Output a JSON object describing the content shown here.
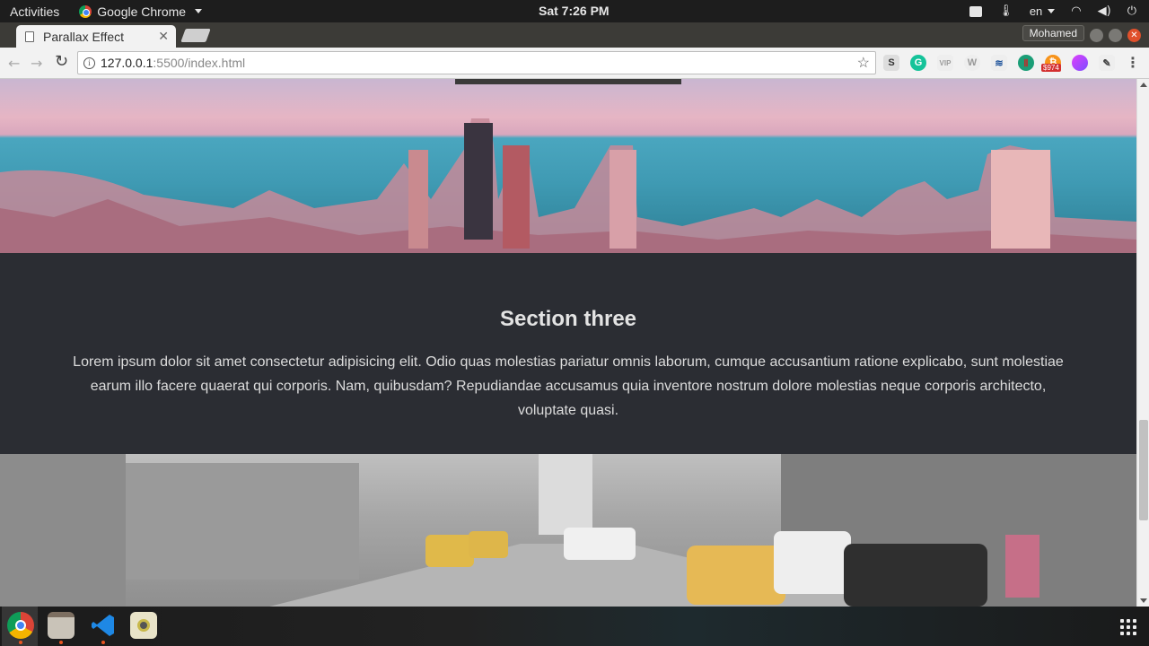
{
  "system_bar": {
    "activities": "Activities",
    "app_name": "Google Chrome",
    "clock": "Sat  7:26 PM",
    "language": "en"
  },
  "browser": {
    "tab_title": "Parallax Effect",
    "profile_name": "Mohamed",
    "url_host": "127.0.0.1",
    "url_rest": ":5500/index.html",
    "extension_badge": "$974"
  },
  "page": {
    "section_three": {
      "heading": "Section three",
      "body": "Lorem ipsum dolor sit amet consectetur adipisicing elit. Odio quas molestias pariatur omnis laborum, cumque accusantium ratione explicabo, sunt molestiae earum illo facere quaerat qui corporis. Nam, quibusdam? Repudiandae accusamus quia inventore nostrum dolore molestias neque corporis architecto, voluptate quasi."
    }
  },
  "dock": {
    "apps": [
      "chrome-icon",
      "files-icon",
      "vscode-icon",
      "rhythmbox-icon",
      "show-apps-icon"
    ]
  },
  "colors": {
    "section_bg": "#2b2d33",
    "ubuntu_orange": "#e95420",
    "tab_bg": "#f2f2f2"
  }
}
